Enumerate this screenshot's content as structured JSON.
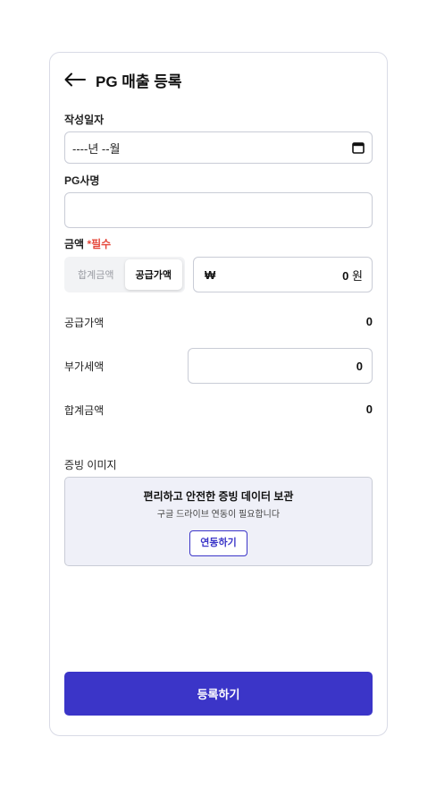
{
  "header": {
    "back_icon": "arrow-left-icon",
    "title": "PG 매출 등록"
  },
  "form": {
    "date": {
      "label": "작성일자",
      "value": "----년 --월",
      "icon": "calendar-icon"
    },
    "pg_name": {
      "label": "PG사명",
      "value": ""
    },
    "amount": {
      "label": "금액",
      "required_mark": "*필수",
      "segments": [
        "합계금액",
        "공급가액"
      ],
      "selected_segment": "공급가액",
      "currency_symbol": "₩",
      "value": "0",
      "unit": "원"
    },
    "supply_value": {
      "label": "공급가액",
      "value": "0"
    },
    "vat": {
      "label": "부가세액",
      "value": "0"
    },
    "total": {
      "label": "합계금액",
      "value": "0"
    },
    "proof_image": {
      "label": "증빙 이미지",
      "title": "편리하고 안전한 증빙 데이터 보관",
      "subtitle": "구글 드라이브 연동이 필요합니다",
      "button_label": "연동하기"
    }
  },
  "submit_label": "등록하기",
  "colors": {
    "accent": "#3b35c8",
    "required": "#e5483b",
    "border": "#c9ccd6",
    "proof_bg": "#eff0f8"
  }
}
